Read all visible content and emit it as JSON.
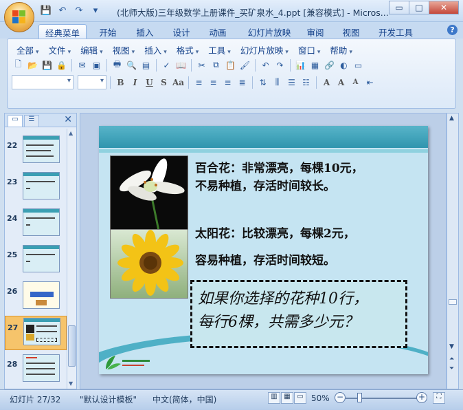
{
  "window": {
    "title": "(北师大版)三年级数学上册课件_买矿泉水_4.ppt [兼容模式] - Micros...",
    "min_label": "▭",
    "max_label": "□",
    "close_label": "✕"
  },
  "ribbon_tabs": [
    "经典菜单",
    "开始",
    "插入",
    "设计",
    "动画",
    "幻灯片放映",
    "审阅",
    "视图",
    "开发工具"
  ],
  "menus": [
    "全部",
    "文件",
    "编辑",
    "视图",
    "插入",
    "格式",
    "工具",
    "幻灯片放映",
    "窗口",
    "帮助"
  ],
  "slides": [
    {
      "num": "22"
    },
    {
      "num": "23"
    },
    {
      "num": "24"
    },
    {
      "num": "25"
    },
    {
      "num": "26"
    },
    {
      "num": "27"
    },
    {
      "num": "28"
    }
  ],
  "slide": {
    "lily_line1": "百合花：非常漂亮，每棵10元，",
    "lily_line2": "不易种植，存活时间较长。",
    "sun_line1": "太阳花：比较漂亮，每棵2元，",
    "sun_line2": "容易种植，存活时间较短。",
    "question_line1": "如果你选择的花种10行，",
    "question_line2": "每行6棵，共需多少元？"
  },
  "status": {
    "slide_info": "幻灯片 27/32",
    "template": "\"默认设计模板\"",
    "language": "中文(简体，中国)",
    "zoom": "50%",
    "zoom_level": 0.2
  },
  "colors": {
    "accent": "#15428b",
    "slide_bg": "#c5e4f2",
    "slide_band": "#2f95ae",
    "selected_thumb": "#f6c46b"
  }
}
